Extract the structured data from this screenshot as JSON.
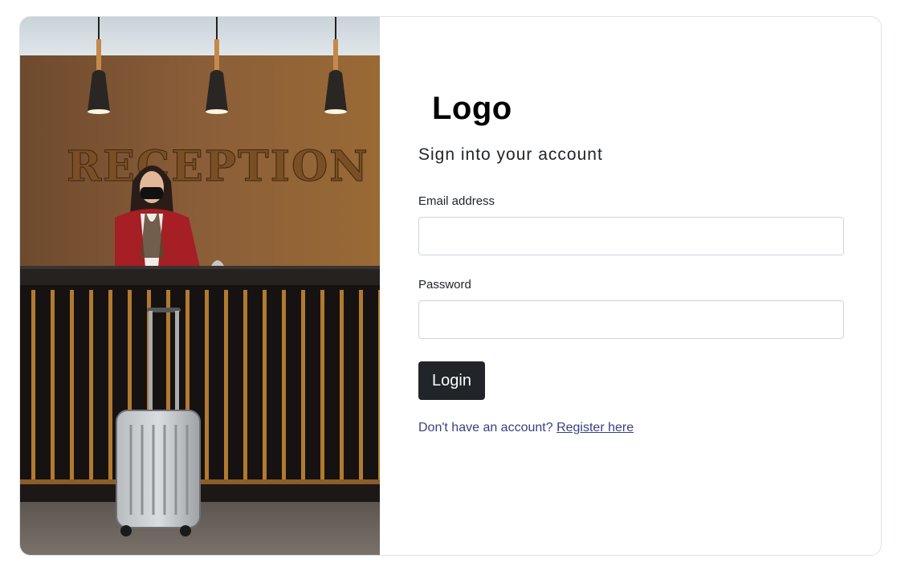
{
  "logo": {
    "text": "Logo"
  },
  "heading": {
    "subtitle": "Sign into your account"
  },
  "form": {
    "email_label": "Email address",
    "email_value": "",
    "password_label": "Password",
    "password_value": "",
    "login_label": "Login"
  },
  "register": {
    "prompt": "Don't have an account?",
    "link_text": "Register here"
  },
  "photo": {
    "sign_text": "RECEPTION"
  },
  "colors": {
    "button_bg": "#212529",
    "link_color": "#393f81",
    "border": "#dee2e6"
  }
}
